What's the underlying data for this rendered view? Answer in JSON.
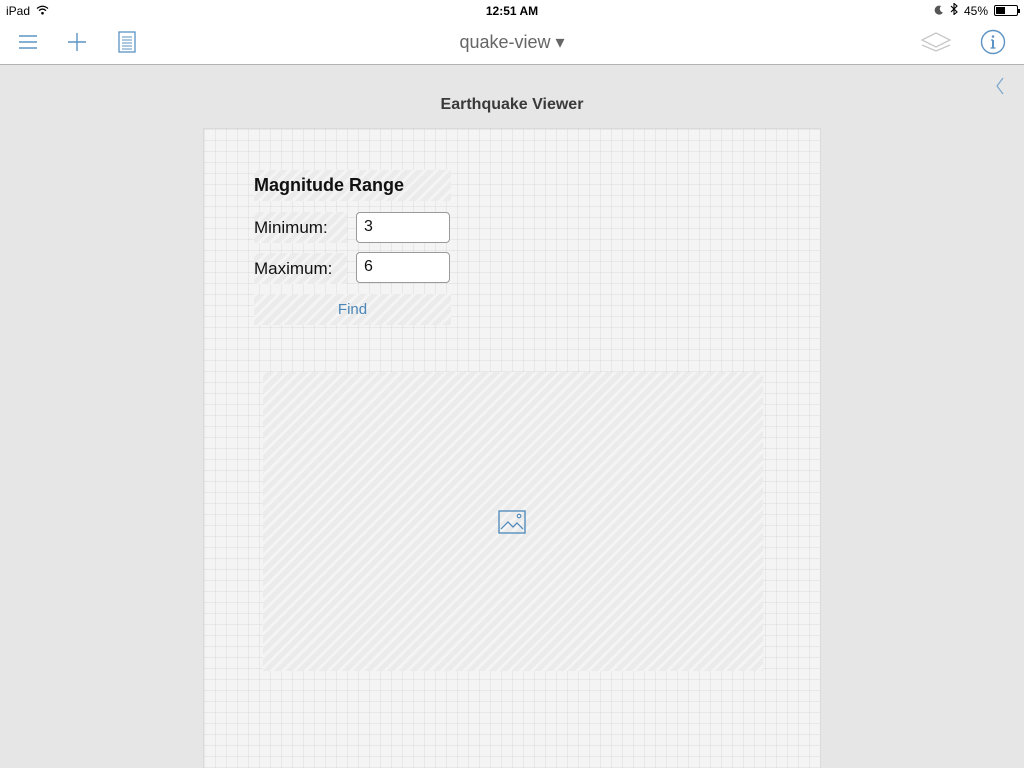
{
  "status_bar": {
    "device": "iPad",
    "time": "12:51 AM",
    "battery_percent": "45%",
    "battery_level": 0.45,
    "icons": [
      "wifi-icon",
      "moon-icon",
      "bluetooth-icon",
      "battery-icon"
    ]
  },
  "toolbar": {
    "document_title": "quake-view ▾",
    "left_buttons": [
      "menu-icon",
      "plus-icon",
      "page-icon"
    ],
    "right_buttons": [
      "layers-icon",
      "info-icon"
    ]
  },
  "canvas": {
    "title": "Earthquake Viewer"
  },
  "form": {
    "section_title": "Magnitude Range",
    "minimum_label": "Minimum:",
    "minimum_value": "3",
    "maximum_label": "Maximum:",
    "maximum_value": "6",
    "find_label": "Find"
  },
  "colors": {
    "accent": "#4a86b8",
    "toolbar_icon": "#5b93c4",
    "background": "#e6e6e6"
  }
}
